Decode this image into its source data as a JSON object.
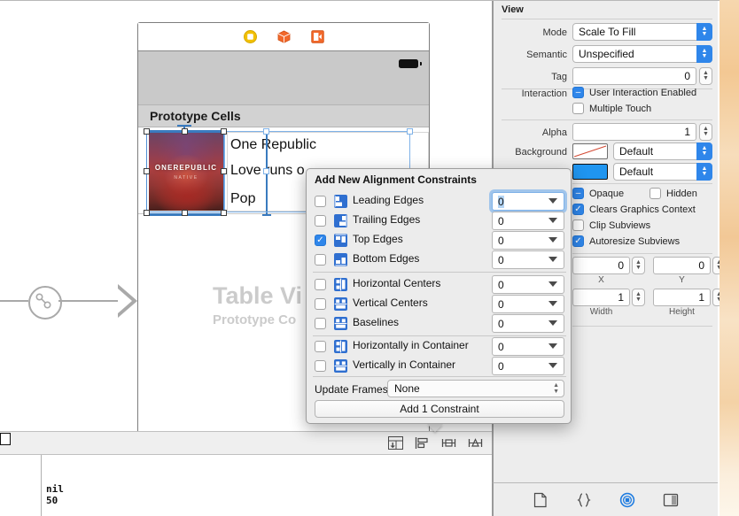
{
  "canvas": {
    "scene_dock": [
      {
        "icon": "view-controller-icon",
        "color": "#f2c000"
      },
      {
        "icon": "first-responder-cube-icon",
        "color": "#f2682a"
      },
      {
        "icon": "exit-segue-icon",
        "color": "#f2682a"
      }
    ],
    "section_header": "Prototype Cells",
    "cell": {
      "album_art_title": "ONEREPUBLIC",
      "album_art_subtitle": "NATIVE",
      "title": "One Republic",
      "subtitle": "Love runs o",
      "genre": "Pop"
    },
    "watermark_line1": "Table Vi",
    "watermark_line2": "Prototype Co",
    "autolayout_icons": [
      {
        "name": "update-frames-icon",
        "glyph": "⭳"
      },
      {
        "name": "align-icon",
        "glyph": "▤"
      },
      {
        "name": "pin-icon",
        "glyph": "⊢⊣"
      },
      {
        "name": "resolve-issues-icon",
        "glyph": "△"
      }
    ],
    "console": "nil\n50"
  },
  "inspector": {
    "title": "View",
    "mode": {
      "label": "Mode",
      "value": "Scale To Fill"
    },
    "semantic": {
      "label": "Semantic",
      "value": "Unspecified"
    },
    "tag": {
      "label": "Tag",
      "value": "0"
    },
    "interaction": {
      "label": "Interaction",
      "user_interaction_enabled": {
        "label": "User Interaction Enabled",
        "state": "mixed"
      },
      "multiple_touch": {
        "label": "Multiple Touch",
        "state": "off"
      }
    },
    "alpha": {
      "label": "Alpha",
      "value": "1"
    },
    "background": {
      "label": "Background",
      "value": "Default",
      "swatch": "#ffffff"
    },
    "tint": {
      "label": "",
      "value": "Default",
      "swatch": "#1f95f0"
    },
    "drawing": {
      "opaque": {
        "label": "Opaque",
        "state": "mixed"
      },
      "hidden": {
        "label": "Hidden",
        "state": "off"
      },
      "clears_graphics_context": {
        "label": "Clears Graphics Context",
        "state": "on"
      },
      "clip_subviews": {
        "label": "Clip Subviews",
        "state": "off"
      },
      "autoresize_subviews": {
        "label": "Autoresize Subviews",
        "state": "on"
      }
    },
    "geometry": {
      "x": {
        "label": "X",
        "value": "0"
      },
      "y": {
        "label": "Y",
        "value": "0"
      },
      "width": {
        "label": "Width",
        "value": "1"
      },
      "height": {
        "label": "Height",
        "value": "1"
      }
    },
    "tabs": [
      {
        "name": "file-inspector-icon",
        "selected": false
      },
      {
        "name": "quick-help-inspector-icon",
        "selected": false
      },
      {
        "name": "size-inspector-icon",
        "selected": true
      },
      {
        "name": "identity-inspector-icon",
        "selected": false
      }
    ]
  },
  "popover": {
    "title": "Add New Alignment Constraints",
    "rows": [
      {
        "label": "Leading Edges",
        "checked": false,
        "value": "0",
        "focused": true,
        "icon": "align-leading-edges-icon"
      },
      {
        "label": "Trailing Edges",
        "checked": false,
        "value": "0",
        "focused": false,
        "icon": "align-trailing-edges-icon"
      },
      {
        "label": "Top Edges",
        "checked": true,
        "value": "0",
        "focused": false,
        "icon": "align-top-edges-icon"
      },
      {
        "label": "Bottom Edges",
        "checked": false,
        "value": "0",
        "focused": false,
        "icon": "align-bottom-edges-icon"
      },
      {
        "label": "Horizontal Centers",
        "checked": false,
        "value": "0",
        "focused": false,
        "icon": "align-horizontal-centers-icon"
      },
      {
        "label": "Vertical Centers",
        "checked": false,
        "value": "0",
        "focused": false,
        "icon": "align-vertical-centers-icon"
      },
      {
        "label": "Baselines",
        "checked": false,
        "value": "0",
        "focused": false,
        "icon": "align-baselines-icon"
      },
      {
        "label": "Horizontally in Container",
        "checked": false,
        "value": "0",
        "focused": false,
        "icon": "align-horizontally-in-container-icon"
      },
      {
        "label": "Vertically in Container",
        "checked": false,
        "value": "0",
        "focused": false,
        "icon": "align-vertically-in-container-icon"
      }
    ],
    "update_frames_label": "Update Frames",
    "update_frames_value": "None",
    "add_button": "Add 1 Constraint"
  }
}
